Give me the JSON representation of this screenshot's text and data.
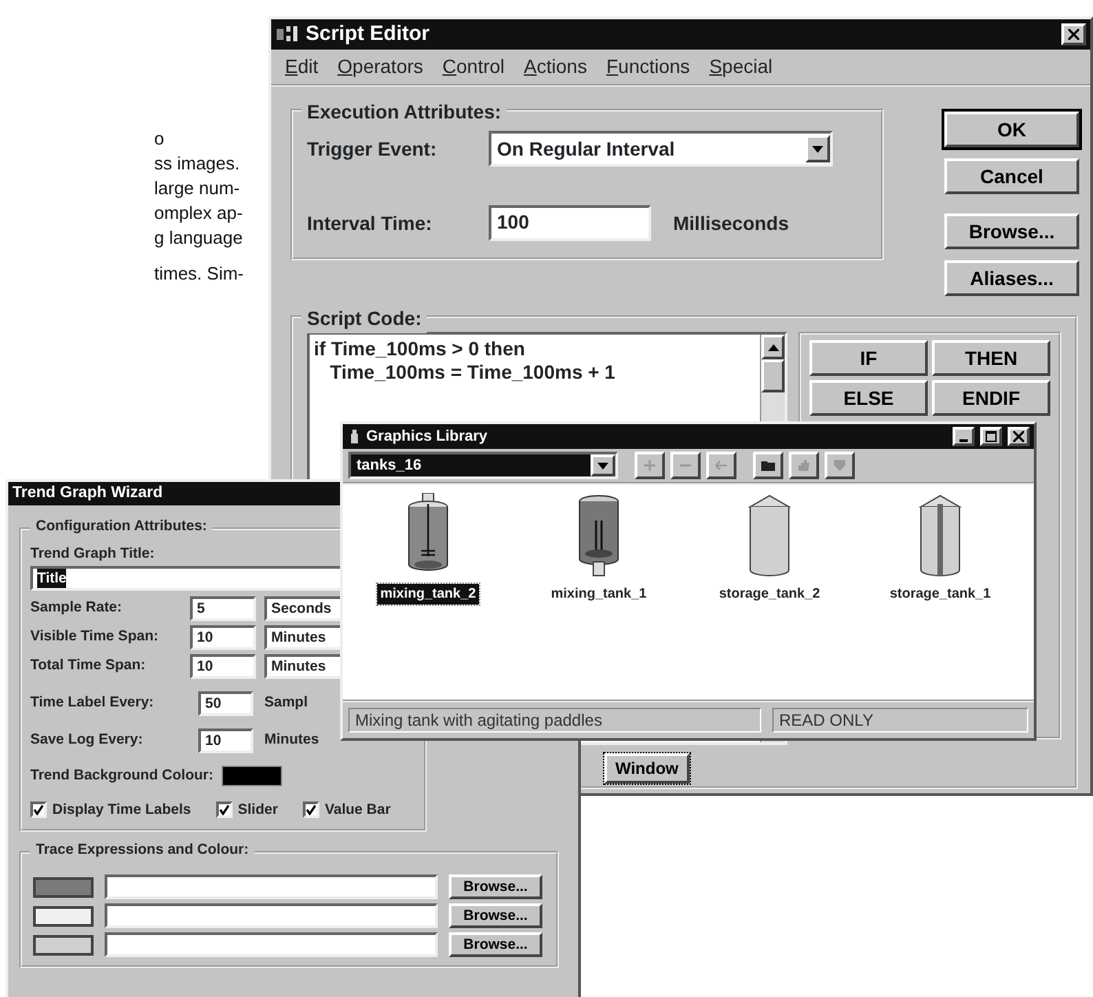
{
  "page_text": {
    "lines": [
      "o",
      "ss images.",
      "large num-",
      "omplex ap-",
      "g language",
      "times. Sim-"
    ]
  },
  "script_editor": {
    "title": "Script Editor",
    "menu": [
      "Edit",
      "Operators",
      "Control",
      "Actions",
      "Functions",
      "Special"
    ],
    "execution": {
      "title": "Execution Attributes:",
      "trigger_label": "Trigger Event:",
      "trigger_value": "On Regular Interval",
      "interval_label": "Interval Time:",
      "interval_value": "100",
      "interval_unit": "Milliseconds"
    },
    "buttons": [
      {
        "label": "OK",
        "default": true
      },
      {
        "label": "Cancel",
        "default": false
      },
      {
        "label": "Browse...",
        "default": false
      },
      {
        "label": "Aliases...",
        "default": false
      }
    ],
    "script_code": {
      "title": "Script Code:",
      "lines": [
        "if Time_100ms > 0 then",
        "   Time_100ms = Time_100ms + 1"
      ],
      "keywords": [
        "IF",
        "THEN",
        "ELSE",
        "ENDIF"
      ],
      "window_button": "Window"
    }
  },
  "trend_wizard": {
    "title": "Trend Graph Wizard",
    "config_title": "Configuration Attributes:",
    "graph_title_label": "Trend Graph Title:",
    "graph_title_value": "Title",
    "rows": [
      {
        "kind": "select",
        "label": "Sample Rate:",
        "value": "5",
        "unit": "Seconds"
      },
      {
        "kind": "select",
        "label": "Visible Time Span:",
        "value": "10",
        "unit": "Minutes"
      },
      {
        "kind": "select",
        "label": "Total Time Span:",
        "value": "10",
        "unit": "Minutes"
      },
      {
        "kind": "text",
        "label": "Time Label Every:",
        "value": "50",
        "unit": "Sampl"
      },
      {
        "kind": "text",
        "label": "Save Log Every:",
        "value": "10",
        "unit": "Minutes"
      }
    ],
    "background_label": "Trend Background Colour:",
    "checkboxes": [
      {
        "label": "Display Time Labels",
        "checked": true
      },
      {
        "label": "Slider",
        "checked": true
      },
      {
        "label": "Value Bar",
        "checked": true
      }
    ],
    "trace_title": "Trace Expressions and Colour:",
    "traces": [
      {
        "color": "#7a7a7a",
        "button": "Browse..."
      },
      {
        "color": "#f0f0f0",
        "button": "Browse..."
      },
      {
        "color": "#cfcfcf",
        "button": "Browse..."
      }
    ]
  },
  "graphics_library": {
    "title": "Graphics Library",
    "set": "tanks_16",
    "tools": [
      {
        "kind": "add",
        "enabled": false
      },
      {
        "kind": "remove",
        "enabled": false
      },
      {
        "kind": "back",
        "enabled": false
      },
      {
        "kind": "folder",
        "enabled": true
      },
      {
        "kind": "hand",
        "enabled": false
      },
      {
        "kind": "shield",
        "enabled": false
      }
    ],
    "items": [
      {
        "label": "mixing_tank_2",
        "kind": "agitator",
        "selected": true
      },
      {
        "label": "mixing_tank_1",
        "kind": "mixer",
        "selected": false
      },
      {
        "label": "storage_tank_2",
        "kind": "plain",
        "selected": false
      },
      {
        "label": "storage_tank_1",
        "kind": "striped",
        "selected": false
      }
    ],
    "status": "Mixing tank with agitating paddles",
    "mode": "READ ONLY"
  }
}
